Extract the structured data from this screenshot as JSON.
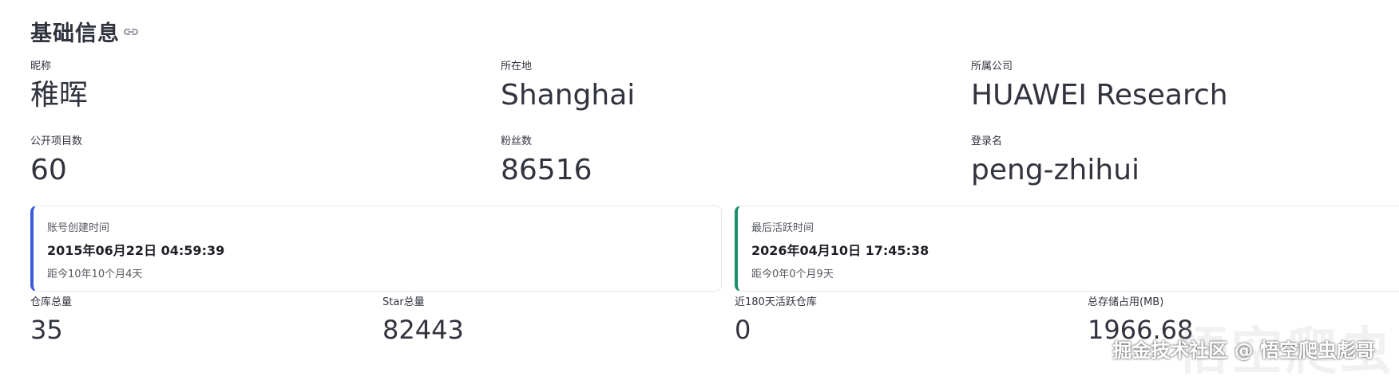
{
  "section": {
    "title": "基础信息",
    "link_icon": "link-icon"
  },
  "profile": {
    "nickname": {
      "label": "昵称",
      "value": "稚晖"
    },
    "location": {
      "label": "所在地",
      "value": "Shanghai"
    },
    "company": {
      "label": "所属公司",
      "value": "HUAWEI Research"
    },
    "public_repos": {
      "label": "公开项目数",
      "value": "60"
    },
    "followers": {
      "label": "粉丝数",
      "value": "86516"
    },
    "login": {
      "label": "登录名",
      "value": "peng-zhihui"
    }
  },
  "cards": {
    "created": {
      "label": "账号创建时间",
      "date": "2015年06月22日 04:59:39",
      "ago": "距今10年10个月4天",
      "accent": "#3b5bdb"
    },
    "last_active": {
      "label": "最后活跃时间",
      "date": "2026年04月10日 17:45:38",
      "ago": "距今0年0个月9天",
      "accent": "#1a8f6b"
    }
  },
  "stats": {
    "repos_total": {
      "label": "仓库总量",
      "value": "35"
    },
    "stars_total": {
      "label": "Star总量",
      "value": "82443"
    },
    "active_repos_180": {
      "label": "近180天活跃仓库",
      "value": "0"
    },
    "storage_mb": {
      "label": "总存储占用(MB)",
      "value": "1966.68"
    }
  },
  "watermark": {
    "big": "悟空爬虫",
    "text": "掘金技术社区 @ 悟空爬虫彪哥"
  }
}
